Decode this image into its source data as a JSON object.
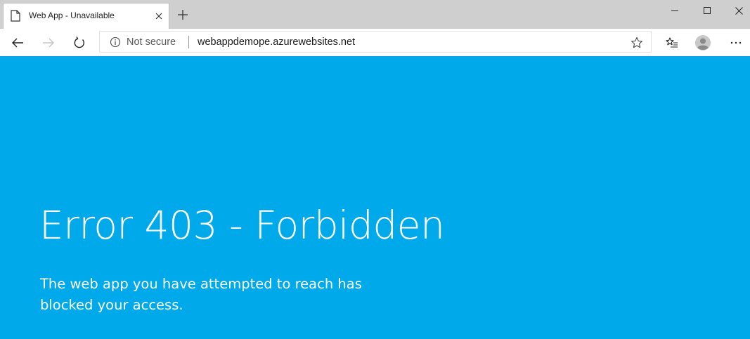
{
  "browser": {
    "tab": {
      "title": "Web App - Unavailable",
      "favicon": "page-icon"
    },
    "address_bar": {
      "security_label": "Not secure",
      "url": "webappdemope.azurewebsites.net"
    },
    "icons": {
      "back": "back-arrow-icon",
      "forward": "forward-arrow-icon",
      "refresh": "refresh-icon",
      "info": "info-icon",
      "favorite": "star-icon",
      "favorites_list": "favorites-list-icon",
      "profile": "profile-avatar-icon",
      "menu": "more-icon",
      "new_tab": "plus-icon",
      "close_tab": "close-icon",
      "minimize": "minimize-icon",
      "maximize": "maximize-icon",
      "close_window": "close-icon"
    }
  },
  "page": {
    "title": "Error 403 - Forbidden",
    "message": "The web app you have attempted to reach has blocked your access."
  },
  "colors": {
    "page_background": "#00a9e9",
    "text": "#ffffff",
    "tabbar": "#cfcfcf"
  }
}
